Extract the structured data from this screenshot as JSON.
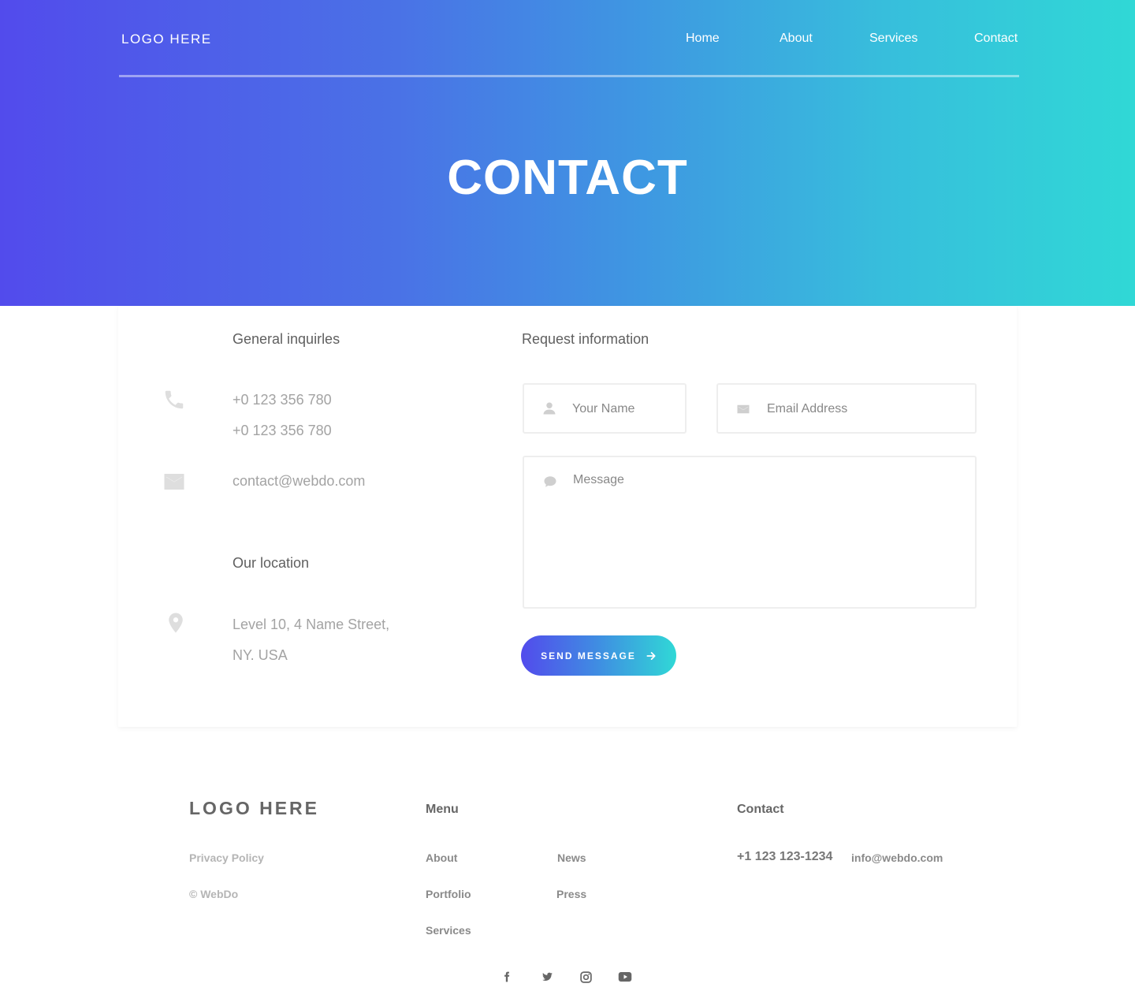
{
  "nav": {
    "logo": "LOGO HERE",
    "links": [
      "Home",
      "About",
      "Services",
      "Contact"
    ]
  },
  "hero": {
    "title": "CONTACT"
  },
  "info": {
    "general_heading": "General inquirles",
    "phone_1": "+0 123 356 780",
    "phone_2": "+0 123 356 780",
    "email": "contact@webdo.com",
    "location_heading": "Our location",
    "address_line_1": "Level 10, 4 Name Street,",
    "address_line_2": "NY. USA"
  },
  "form": {
    "heading": "Request information",
    "name_placeholder": "Your Name",
    "email_placeholder": "Email Address",
    "message_placeholder": "Message",
    "send_label": "SEND MESSAGE"
  },
  "footer": {
    "logo": "LOGO HERE",
    "privacy": "Privacy Policy",
    "copyright": "© WebDo",
    "menu_heading": "Menu",
    "menu_col1": [
      "About",
      "Portfolio",
      "Services"
    ],
    "menu_col2": [
      "News",
      "Press"
    ],
    "contact_heading": "Contact",
    "phone": "+1 123 123-1234",
    "email": "info@webdo.com",
    "social": [
      "facebook-icon",
      "twitter-icon",
      "instagram-icon",
      "youtube-icon"
    ]
  },
  "colors": {
    "gradient_start": "#524bec",
    "gradient_end": "#30d8d6"
  }
}
